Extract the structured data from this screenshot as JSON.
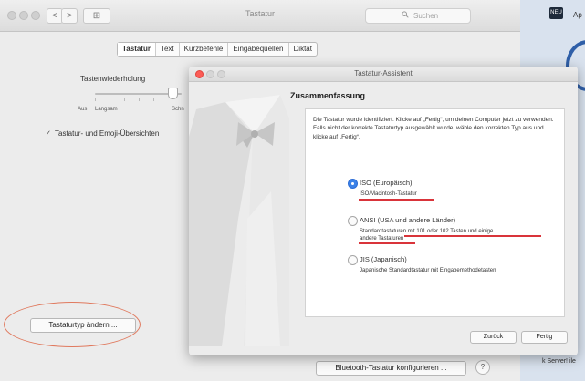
{
  "main_window": {
    "title": "Tastatur",
    "search_placeholder": "Suchen",
    "nav_back": "<",
    "nav_forward": ">",
    "grid_label": "⊞",
    "tabs": [
      {
        "label": "Tastatur",
        "active": true
      },
      {
        "label": "Text",
        "active": false
      },
      {
        "label": "Kurzbefehle",
        "active": false
      },
      {
        "label": "Eingabequellen",
        "active": false
      },
      {
        "label": "Diktat",
        "active": false
      }
    ],
    "key_repeat_label": "Tastenwiederholung",
    "slider_labels": {
      "off": "Aus",
      "slow": "Langsam",
      "fast": "Schn"
    },
    "emoji_checkbox_label": "Tastatur- und Emoji-Übersichten",
    "change_keyboard_type_button": "Tastaturtyp ändern ...",
    "bluetooth_button": "Bluetooth-Tastatur konfigurieren ...",
    "help_button": "?"
  },
  "right_background": {
    "badge": "NEU",
    "text": "Ap",
    "bottom_text": "k Server! ile"
  },
  "assistant": {
    "title": "Tastatur-Assistent",
    "heading": "Zusammenfassung",
    "intro": "Die Tastatur wurde identifiziert. Klicke auf „Fertig“, um deinen Computer jetzt zu verwenden. Falls nicht der korrekte Tastaturtyp ausgewählt wurde, wähle den korrekten Typ aus und klicke auf „Fertig“.",
    "options": [
      {
        "title": "ISO (Europäisch)",
        "desc": "ISO/Macintosh-Tastatur",
        "desc_line2": "",
        "selected": true
      },
      {
        "title": "ANSI (USA und andere Länder)",
        "desc": "Standardtastaturen mit 101 oder 102 Tasten und einige",
        "desc_line2": "andere Tastaturen",
        "selected": false
      },
      {
        "title": "JIS (Japanisch)",
        "desc": "Japanische Standardtastatur mit Eingabemethodetasten",
        "desc_line2": "",
        "selected": false
      }
    ],
    "back_button": "Zurück",
    "done_button": "Fertig"
  },
  "colors": {
    "annotation_red": "#d9343a",
    "annotation_orange": "#e07a5f",
    "radio_selected": "#3b82e8",
    "close_dot": "#fc5c56"
  },
  "icons": [
    "search-icon",
    "chevron-left-icon",
    "chevron-right-icon",
    "grid-icon",
    "checkmark-icon",
    "tuxedo-illustration"
  ]
}
